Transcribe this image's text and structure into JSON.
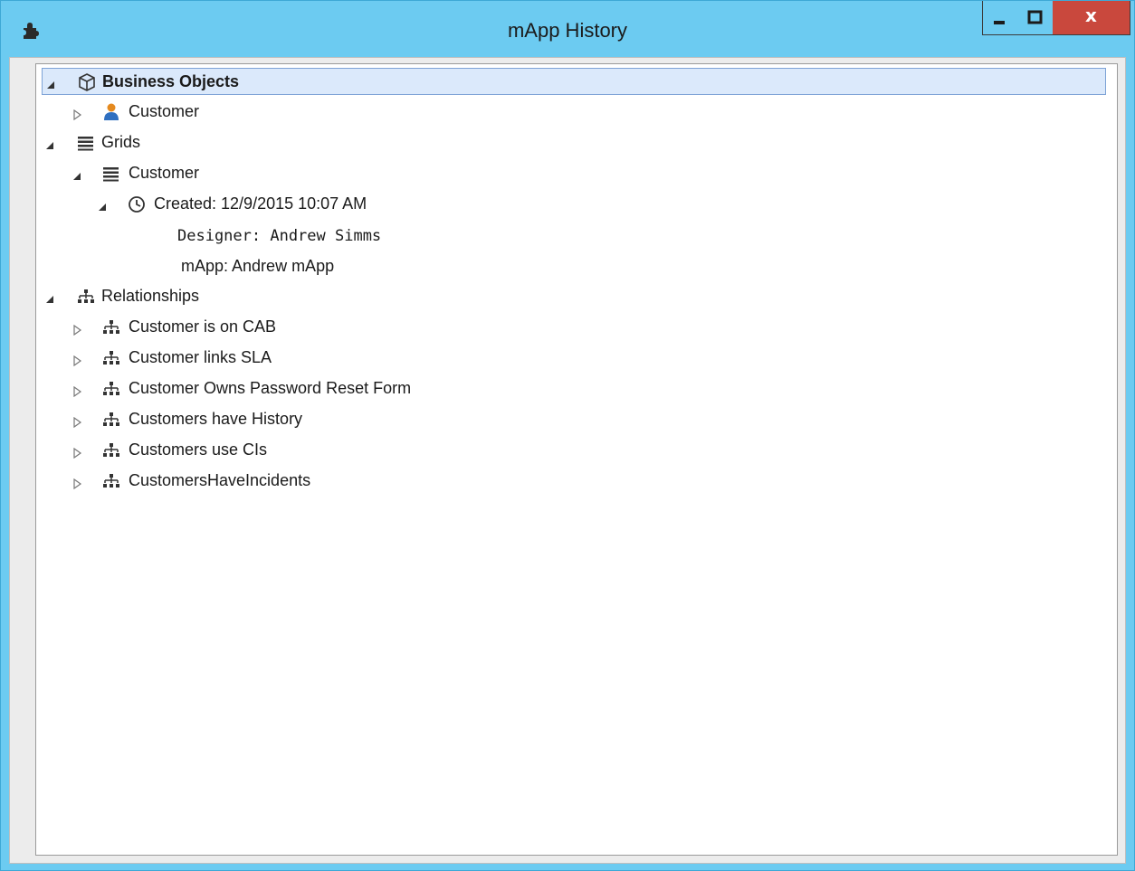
{
  "window": {
    "title": "mApp History",
    "close_label": "x"
  },
  "tree": {
    "business_objects": {
      "label": "Business Objects",
      "children": [
        {
          "label": "Customer"
        }
      ]
    },
    "grids": {
      "label": "Grids",
      "customer": {
        "label": "Customer",
        "created": {
          "label": "Created: 12/9/2015 10:07 AM",
          "designer": "Designer: Andrew Simms",
          "mapp": "mApp: Andrew mApp"
        }
      }
    },
    "relationships": {
      "label": "Relationships",
      "children": [
        {
          "label": "Customer is on CAB"
        },
        {
          "label": "Customer links SLA"
        },
        {
          "label": "Customer Owns Password Reset Form"
        },
        {
          "label": "Customers have History"
        },
        {
          "label": "Customers use CIs"
        },
        {
          "label": "CustomersHaveIncidents"
        }
      ]
    }
  },
  "colors": {
    "titlebar": "#6ccbf1",
    "close_button": "#c9483d",
    "selection": "#dbe9fb"
  },
  "icons": {
    "app": "puzzle-icon",
    "business_objects": "cube-icon",
    "customer_object": "user-icon",
    "grids": "grid-lines-icon",
    "created": "clock-icon",
    "relationships": "hierarchy-icon"
  }
}
